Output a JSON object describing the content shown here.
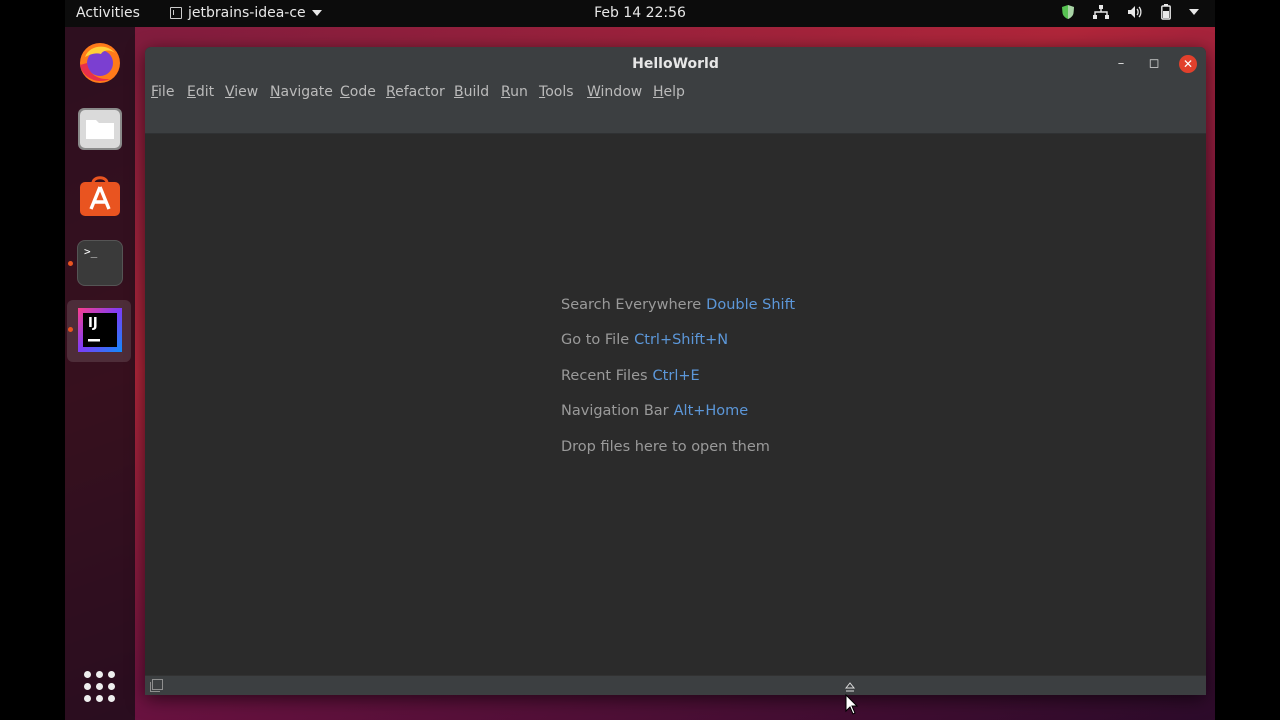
{
  "topbar": {
    "activities_label": "Activities",
    "app_name": "jetbrains-idea-ce",
    "clock": "Feb 14  22:56"
  },
  "dock": {
    "items": [
      "firefox-icon",
      "files-icon",
      "software-center-icon",
      "terminal-icon",
      "intellij-icon",
      "show-apps-icon"
    ],
    "accent_color": "#e95420"
  },
  "window": {
    "title": "HelloWorld",
    "menu": [
      "File",
      "Edit",
      "View",
      "Navigate",
      "Code",
      "Refactor",
      "Build",
      "Run",
      "Tools",
      "Window",
      "Help"
    ]
  },
  "editor": {
    "hints": [
      {
        "label": "Search Everywhere",
        "shortcut": "Double Shift"
      },
      {
        "label": "Go to File",
        "shortcut": "Ctrl+Shift+N"
      },
      {
        "label": "Recent Files",
        "shortcut": "Ctrl+E"
      },
      {
        "label": "Navigation Bar",
        "shortcut": "Alt+Home"
      }
    ],
    "drop_text": "Drop files here to open them",
    "shortcut_color": "#5c97d9"
  },
  "dock_terminal_glyph": ">_",
  "dock_ij_glyph": "IJ"
}
